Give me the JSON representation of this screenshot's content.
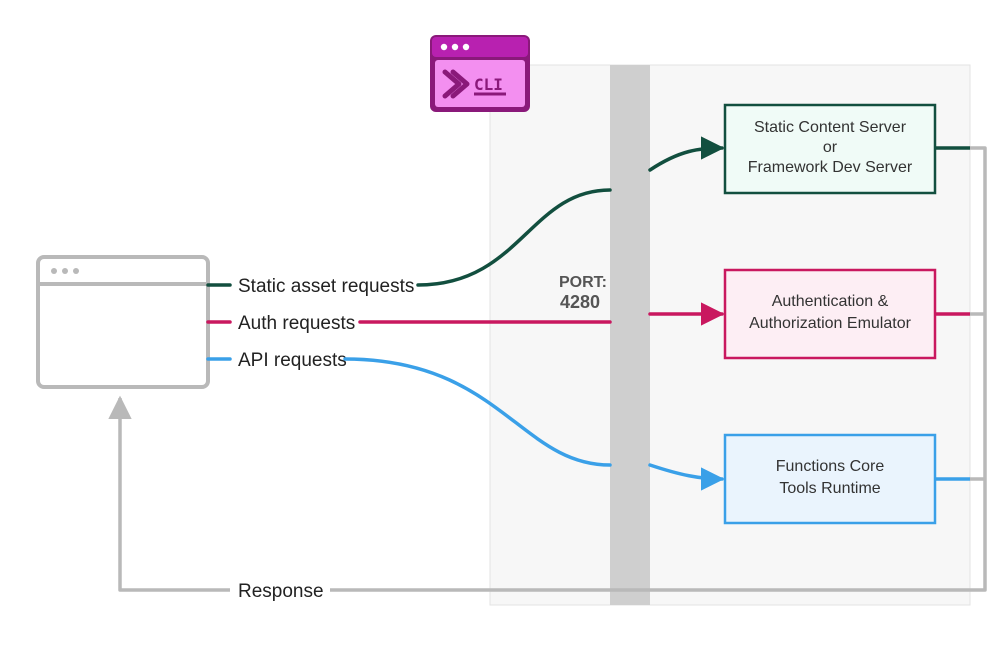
{
  "cli": {
    "label": "CLI"
  },
  "port": {
    "label": "PORT:",
    "value": "4280"
  },
  "requests": {
    "static": "Static asset requests",
    "auth": "Auth requests",
    "api": "API requests"
  },
  "response_label": "Response",
  "services": {
    "static_content": {
      "line1": "Static Content Server",
      "line2": "or",
      "line3": "Framework  Dev  Server"
    },
    "auth": {
      "line1": "Authentication &",
      "line2": "Authorization Emulator"
    },
    "functions": {
      "line1": "Functions Core",
      "line2": "Tools Runtime"
    }
  },
  "colors": {
    "green": "#124f3f",
    "greenFill": "#f0fbf7",
    "magenta": "#c9185f",
    "magentaFill": "#fdeef4",
    "blue": "#3aa0e8",
    "blueFill": "#eaf4fd",
    "grey": "#b9b9b9",
    "cliPurple": "#b821b0",
    "cliPurpleDark": "#8a197a",
    "cliBody": "#f38ff0",
    "portStrip": "#cfcfcf",
    "serverPanel": "#f7f7f7"
  }
}
